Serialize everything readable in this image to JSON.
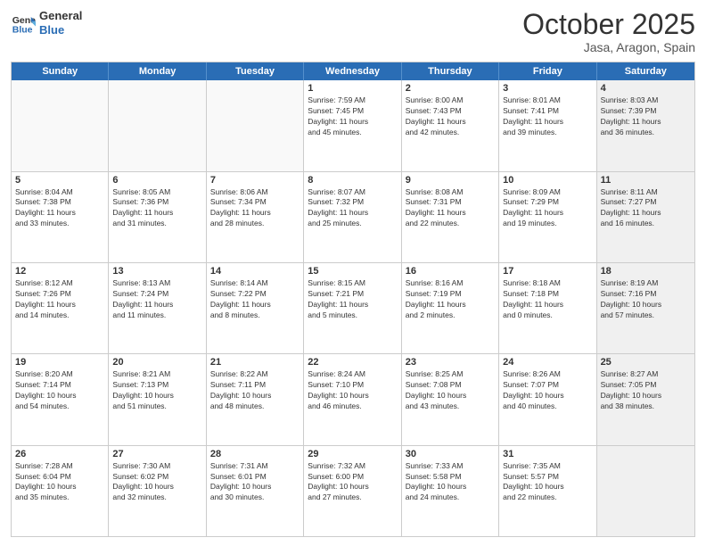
{
  "header": {
    "logo_line1": "General",
    "logo_line2": "Blue",
    "month": "October 2025",
    "location": "Jasa, Aragon, Spain"
  },
  "weekdays": [
    "Sunday",
    "Monday",
    "Tuesday",
    "Wednesday",
    "Thursday",
    "Friday",
    "Saturday"
  ],
  "rows": [
    [
      {
        "day": "",
        "text": "",
        "empty": true
      },
      {
        "day": "",
        "text": "",
        "empty": true
      },
      {
        "day": "",
        "text": "",
        "empty": true
      },
      {
        "day": "1",
        "text": "Sunrise: 7:59 AM\nSunset: 7:45 PM\nDaylight: 11 hours\nand 45 minutes."
      },
      {
        "day": "2",
        "text": "Sunrise: 8:00 AM\nSunset: 7:43 PM\nDaylight: 11 hours\nand 42 minutes."
      },
      {
        "day": "3",
        "text": "Sunrise: 8:01 AM\nSunset: 7:41 PM\nDaylight: 11 hours\nand 39 minutes."
      },
      {
        "day": "4",
        "text": "Sunrise: 8:03 AM\nSunset: 7:39 PM\nDaylight: 11 hours\nand 36 minutes.",
        "shaded": true
      }
    ],
    [
      {
        "day": "5",
        "text": "Sunrise: 8:04 AM\nSunset: 7:38 PM\nDaylight: 11 hours\nand 33 minutes."
      },
      {
        "day": "6",
        "text": "Sunrise: 8:05 AM\nSunset: 7:36 PM\nDaylight: 11 hours\nand 31 minutes."
      },
      {
        "day": "7",
        "text": "Sunrise: 8:06 AM\nSunset: 7:34 PM\nDaylight: 11 hours\nand 28 minutes."
      },
      {
        "day": "8",
        "text": "Sunrise: 8:07 AM\nSunset: 7:32 PM\nDaylight: 11 hours\nand 25 minutes."
      },
      {
        "day": "9",
        "text": "Sunrise: 8:08 AM\nSunset: 7:31 PM\nDaylight: 11 hours\nand 22 minutes."
      },
      {
        "day": "10",
        "text": "Sunrise: 8:09 AM\nSunset: 7:29 PM\nDaylight: 11 hours\nand 19 minutes."
      },
      {
        "day": "11",
        "text": "Sunrise: 8:11 AM\nSunset: 7:27 PM\nDaylight: 11 hours\nand 16 minutes.",
        "shaded": true
      }
    ],
    [
      {
        "day": "12",
        "text": "Sunrise: 8:12 AM\nSunset: 7:26 PM\nDaylight: 11 hours\nand 14 minutes."
      },
      {
        "day": "13",
        "text": "Sunrise: 8:13 AM\nSunset: 7:24 PM\nDaylight: 11 hours\nand 11 minutes."
      },
      {
        "day": "14",
        "text": "Sunrise: 8:14 AM\nSunset: 7:22 PM\nDaylight: 11 hours\nand 8 minutes."
      },
      {
        "day": "15",
        "text": "Sunrise: 8:15 AM\nSunset: 7:21 PM\nDaylight: 11 hours\nand 5 minutes."
      },
      {
        "day": "16",
        "text": "Sunrise: 8:16 AM\nSunset: 7:19 PM\nDaylight: 11 hours\nand 2 minutes."
      },
      {
        "day": "17",
        "text": "Sunrise: 8:18 AM\nSunset: 7:18 PM\nDaylight: 11 hours\nand 0 minutes."
      },
      {
        "day": "18",
        "text": "Sunrise: 8:19 AM\nSunset: 7:16 PM\nDaylight: 10 hours\nand 57 minutes.",
        "shaded": true
      }
    ],
    [
      {
        "day": "19",
        "text": "Sunrise: 8:20 AM\nSunset: 7:14 PM\nDaylight: 10 hours\nand 54 minutes."
      },
      {
        "day": "20",
        "text": "Sunrise: 8:21 AM\nSunset: 7:13 PM\nDaylight: 10 hours\nand 51 minutes."
      },
      {
        "day": "21",
        "text": "Sunrise: 8:22 AM\nSunset: 7:11 PM\nDaylight: 10 hours\nand 48 minutes."
      },
      {
        "day": "22",
        "text": "Sunrise: 8:24 AM\nSunset: 7:10 PM\nDaylight: 10 hours\nand 46 minutes."
      },
      {
        "day": "23",
        "text": "Sunrise: 8:25 AM\nSunset: 7:08 PM\nDaylight: 10 hours\nand 43 minutes."
      },
      {
        "day": "24",
        "text": "Sunrise: 8:26 AM\nSunset: 7:07 PM\nDaylight: 10 hours\nand 40 minutes."
      },
      {
        "day": "25",
        "text": "Sunrise: 8:27 AM\nSunset: 7:05 PM\nDaylight: 10 hours\nand 38 minutes.",
        "shaded": true
      }
    ],
    [
      {
        "day": "26",
        "text": "Sunrise: 7:28 AM\nSunset: 6:04 PM\nDaylight: 10 hours\nand 35 minutes."
      },
      {
        "day": "27",
        "text": "Sunrise: 7:30 AM\nSunset: 6:02 PM\nDaylight: 10 hours\nand 32 minutes."
      },
      {
        "day": "28",
        "text": "Sunrise: 7:31 AM\nSunset: 6:01 PM\nDaylight: 10 hours\nand 30 minutes."
      },
      {
        "day": "29",
        "text": "Sunrise: 7:32 AM\nSunset: 6:00 PM\nDaylight: 10 hours\nand 27 minutes."
      },
      {
        "day": "30",
        "text": "Sunrise: 7:33 AM\nSunset: 5:58 PM\nDaylight: 10 hours\nand 24 minutes."
      },
      {
        "day": "31",
        "text": "Sunrise: 7:35 AM\nSunset: 5:57 PM\nDaylight: 10 hours\nand 22 minutes."
      },
      {
        "day": "",
        "text": "",
        "empty": true,
        "shaded": true
      }
    ]
  ]
}
